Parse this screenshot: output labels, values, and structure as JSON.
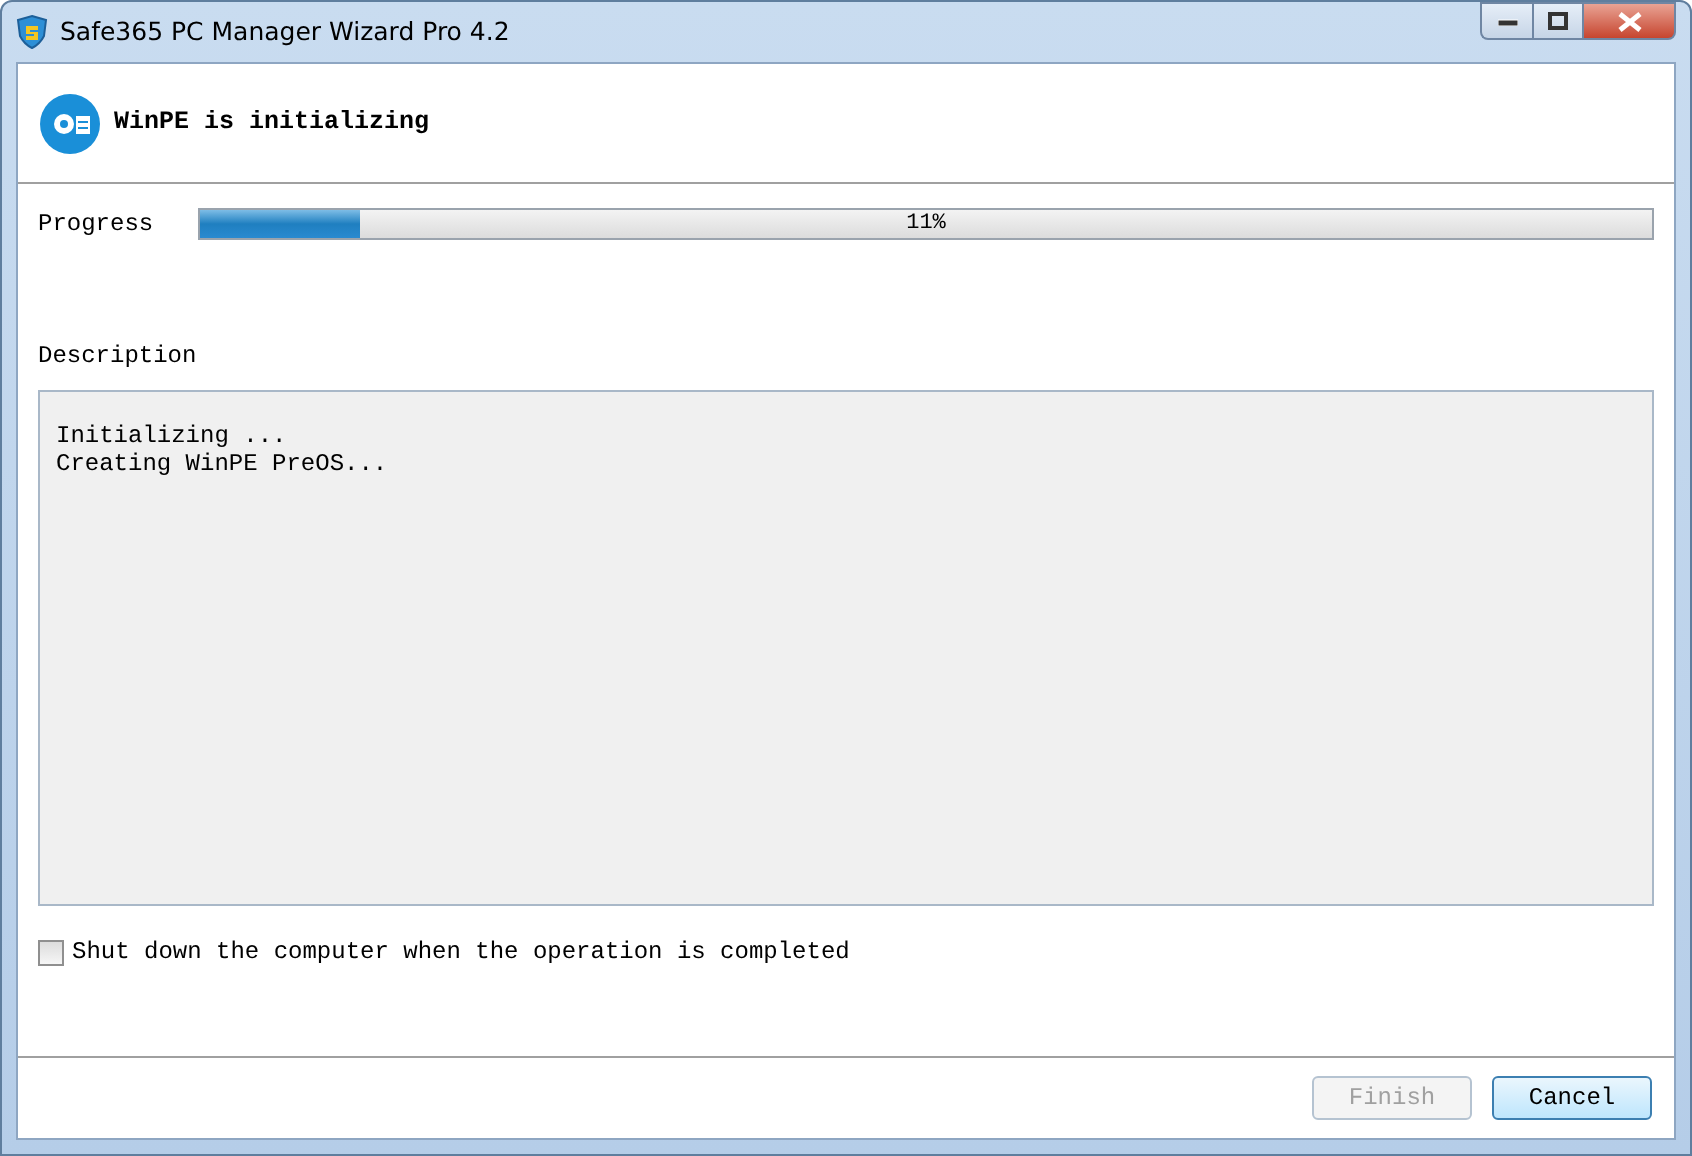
{
  "window": {
    "title": "Safe365 PC Manager Wizard Pro 4.2"
  },
  "header": {
    "title": "WinPE is initializing"
  },
  "progress": {
    "label": "Progress",
    "level": 0.11,
    "reading": "11%"
  },
  "description": {
    "label": "Description",
    "lines": [
      "Initializing ...",
      "Creating WinPE PreOS..."
    ]
  },
  "shutdown_option": {
    "label": "Shut down the computer when the operation is completed",
    "checked": false
  },
  "buttons": [
    {
      "label": "Finish",
      "disabled": true
    },
    {
      "label": "Cancel",
      "disabled": false
    }
  ]
}
